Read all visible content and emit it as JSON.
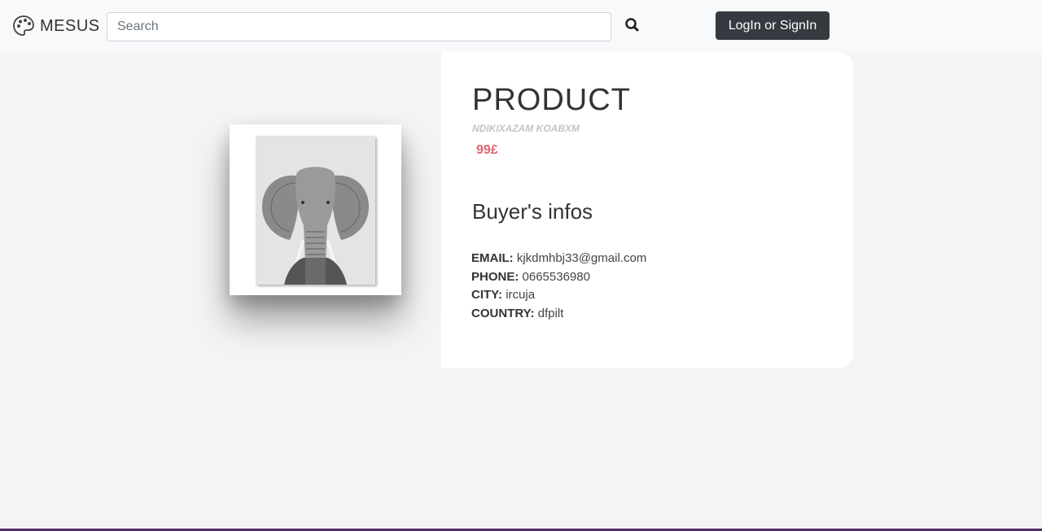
{
  "nav": {
    "brand": "MESUS",
    "brand_icon": "palette-icon",
    "search_placeholder": "Search",
    "search_icon": "search-icon",
    "login_label": "LogIn or SignIn"
  },
  "product": {
    "title": "PRODUCT",
    "subtitle": "NDIKIXAZAM KOABXM",
    "price": "99£",
    "image_icon": "elephant-artwork"
  },
  "buyer": {
    "heading": "Buyer's infos",
    "fields": [
      {
        "label": "EMAIL:",
        "value": "kjkdmhbj33@gmail.com"
      },
      {
        "label": "PHONE:",
        "value": "0665536980"
      },
      {
        "label": "CITY:",
        "value": "ircuja"
      },
      {
        "label": "COUNTRY:",
        "value": "dfpilt"
      }
    ]
  },
  "colors": {
    "navbar_bg": "#f8f9fa",
    "page_bg": "#f4f4f4",
    "button_dark": "#343a40",
    "price_red": "#e06670"
  }
}
